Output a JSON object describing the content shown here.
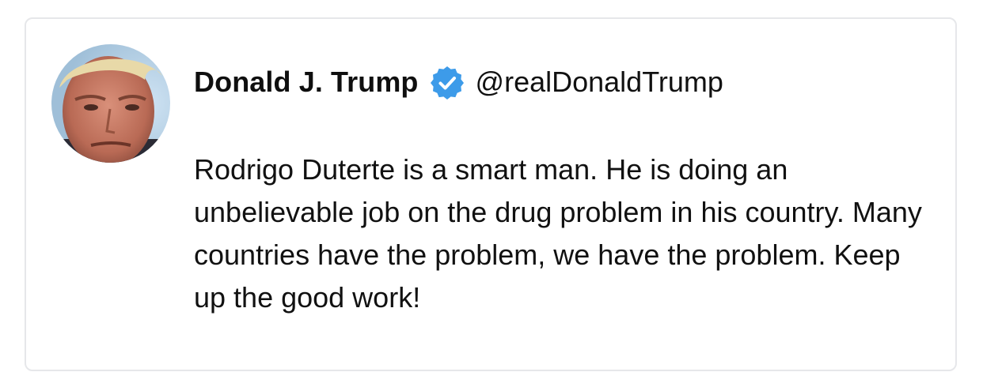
{
  "tweet": {
    "author_name": "Donald J. Trump",
    "handle": "@realDonaldTrump",
    "verified_icon": "verified-badge-icon",
    "avatar": "profile-photo",
    "text": "Rodrigo Duterte is a smart man. He is doing an unbelievable job on the drug problem in his country. Many countries have the problem, we have the problem. Keep up the good work!"
  },
  "colors": {
    "card_border": "#e6e7ea",
    "verified_blue": "#3d9be9",
    "text": "#111111"
  }
}
